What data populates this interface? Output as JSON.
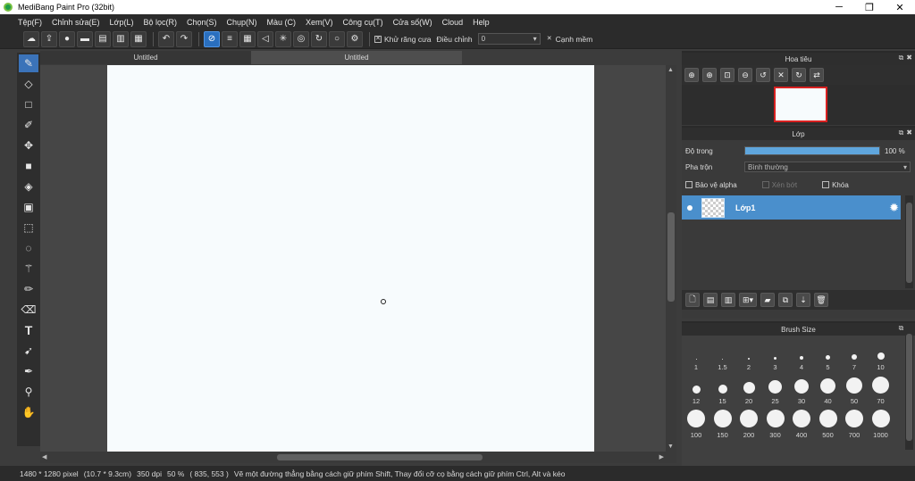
{
  "window": {
    "title": "MediBang Paint Pro (32bit)",
    "minimize": "─",
    "maximize": "❐",
    "close": "✕"
  },
  "menu": [
    "Tệp(F)",
    "Chỉnh sửa(E)",
    "Lớp(L)",
    "Bộ lọc(R)",
    "Chọn(S)",
    "Chụp(N)",
    "Màu (C)",
    "Xem(V)",
    "Công cụ(T)",
    "Cửa số(W)",
    "Cloud",
    "Help"
  ],
  "toolbar": {
    "antialias_label": "Khử răng cưa",
    "adjust_label": "Điều chỉnh",
    "adjust_value": "0",
    "smooth_label": "Cạnh mềm"
  },
  "tabs": [
    {
      "label": "Untitled",
      "active": false
    },
    {
      "label": "Untitled",
      "active": true
    }
  ],
  "navigator": {
    "title": "Hoa tiêu"
  },
  "layer_panel": {
    "title": "Lớp",
    "opacity_label": "Độ trong",
    "opacity_value": "100 %",
    "opacity_fraction": 1.0,
    "blend_label": "Pha trộn",
    "blend_value": "Bình thường",
    "protect_alpha": "Bảo vệ alpha",
    "clipping": "Xén bớt",
    "lock": "Khóa",
    "layers": [
      {
        "name": "Lớp1",
        "selected": true
      }
    ]
  },
  "brush_panel": {
    "title": "Brush Size",
    "sizes": [
      "1",
      "1.5",
      "2",
      "3",
      "4",
      "5",
      "7",
      "10",
      "12",
      "15",
      "20",
      "25",
      "30",
      "40",
      "50",
      "70",
      "100",
      "150",
      "200",
      "300",
      "400",
      "500",
      "700",
      "1000"
    ]
  },
  "status": {
    "canvas_size": "1480 * 1280 pixel",
    "physical_size": "(10.7 * 9.3cm)",
    "dpi": "350 dpi",
    "zoom": "50 %",
    "cursor_pos": "( 835, 553 )",
    "hint": "Vẽ một đường thẳng bằng cách giữ phím Shift, Thay đổi cỡ cọ bằng cách giữ phím Ctrl, Alt và kéo"
  },
  "accent_color": "#4a8fcc",
  "icons": {
    "tools": [
      "brush-icon",
      "eraser-icon",
      "dot-icon",
      "smudge-icon",
      "move-icon",
      "fill-rect-icon",
      "bucket-icon",
      "gradient-icon",
      "select-rect-icon",
      "lasso-icon",
      "magic-wand-icon",
      "select-pen-icon",
      "select-eraser-icon",
      "text-icon",
      "operation-icon",
      "dropper-icon",
      "pipette-icon",
      "hand-icon"
    ]
  }
}
